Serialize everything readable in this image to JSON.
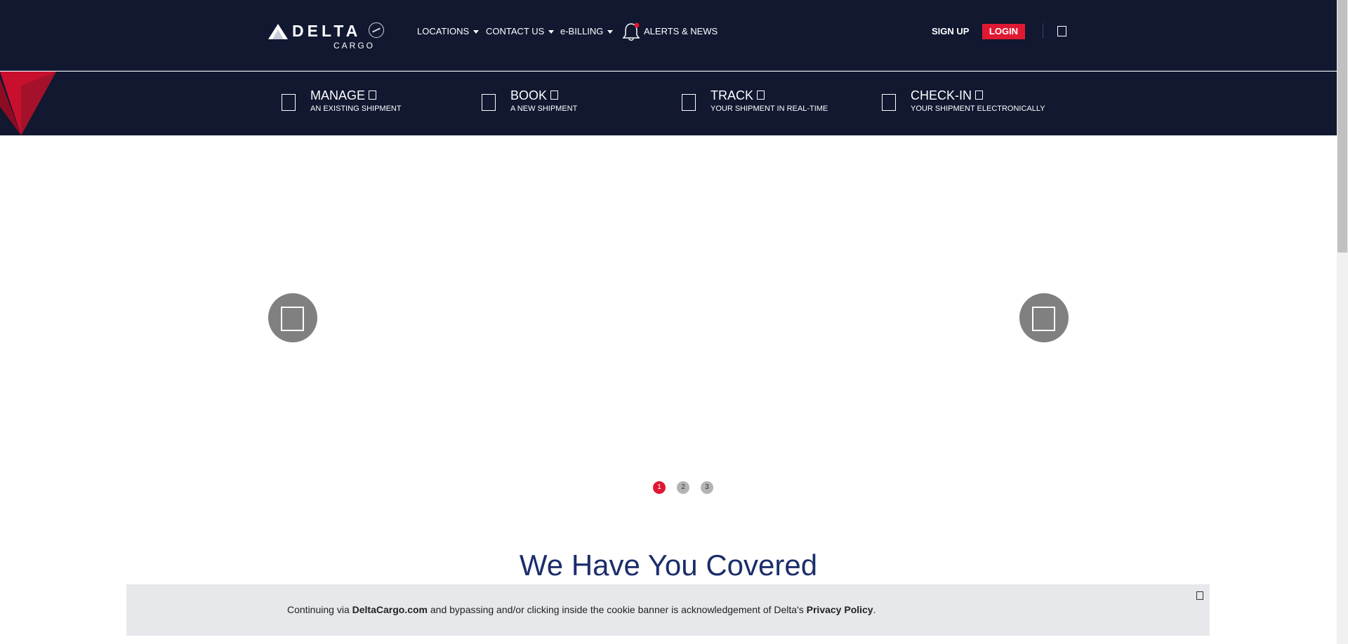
{
  "header": {
    "logo_text": "DELTA",
    "logo_sub": "CARGO",
    "nav": [
      {
        "label": "LOCATIONS",
        "has_caret": true
      },
      {
        "label": "CONTACT US",
        "has_caret": true
      },
      {
        "label": "e-BILLING",
        "has_caret": true
      }
    ],
    "alerts_label": "ALERTS & NEWS",
    "signup_label": "SIGN UP",
    "login_label": "LOGIN",
    "user_icon": "user-icon"
  },
  "subnav": {
    "items": [
      {
        "title": "MANAGE",
        "subtitle": "AN EXISTING SHIPMENT",
        "icon": "manage-icon"
      },
      {
        "title": "BOOK",
        "subtitle": "A NEW SHIPMENT",
        "icon": "book-icon"
      },
      {
        "title": "TRACK",
        "subtitle": "YOUR SHIPMENT IN REAL-TIME",
        "icon": "track-icon"
      },
      {
        "title": "CHECK-IN",
        "subtitle": "YOUR SHIPMENT ELECTRONICALLY",
        "icon": "checkin-icon"
      }
    ]
  },
  "carousel": {
    "prev_icon": "chevron-left-icon",
    "next_icon": "chevron-right-icon",
    "dots": [
      "1",
      "2",
      "3"
    ],
    "active_index": 0
  },
  "main": {
    "heading": "We Have You Covered"
  },
  "cookie_banner": {
    "text_1": "Continuing via ",
    "brand": "DeltaCargo.com",
    "text_2": " and bypassing and/or clicking inside the cookie banner is acknowledgement of Delta's ",
    "policy_link": "Privacy Policy",
    "text_3": "."
  },
  "colors": {
    "nav_bg": "#111830",
    "accent_red": "#e01933",
    "heading_blue": "#1b2e6b",
    "cookie_bg": "#e6e8ec"
  }
}
